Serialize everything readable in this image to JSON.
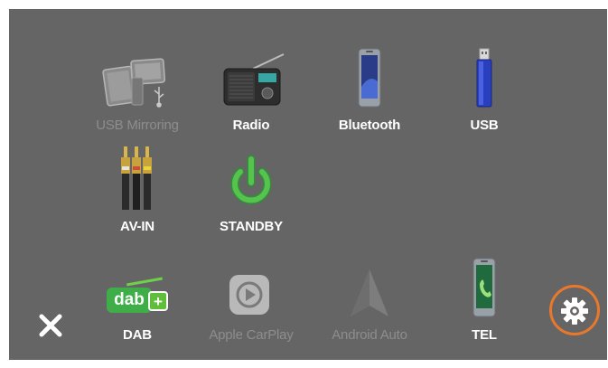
{
  "menu": {
    "row1": [
      {
        "label": "USB Mirroring",
        "icon": "usb-mirroring-icon",
        "enabled": false
      },
      {
        "label": "Radio",
        "icon": "radio-icon",
        "enabled": true
      },
      {
        "label": "Bluetooth",
        "icon": "bluetooth-phone-icon",
        "enabled": true
      },
      {
        "label": "USB",
        "icon": "usb-drive-icon",
        "enabled": true
      }
    ],
    "row2": [
      {
        "label": "AV-IN",
        "icon": "rca-cable-icon",
        "enabled": true
      },
      {
        "label": "STANDBY",
        "icon": "power-icon",
        "enabled": true
      }
    ],
    "dock": [
      {
        "label": "DAB",
        "icon": "dab-plus-icon",
        "enabled": true
      },
      {
        "label": "Apple CarPlay",
        "icon": "carplay-icon",
        "enabled": false
      },
      {
        "label": "Android Auto",
        "icon": "android-auto-icon",
        "enabled": false
      },
      {
        "label": "TEL",
        "icon": "phone-call-icon",
        "enabled": true
      }
    ]
  },
  "dab_logo": {
    "text": "dab",
    "plus": "+"
  },
  "controls": {
    "close_icon": "close-icon",
    "settings_icon": "gear-icon"
  },
  "colors": {
    "background": "#656565",
    "label": "#ffffff",
    "label_disabled": "#8d8d8d",
    "highlight_ring": "#e8792c",
    "standby_green": "#3fae49",
    "dab_green": "#5fbf3a"
  }
}
